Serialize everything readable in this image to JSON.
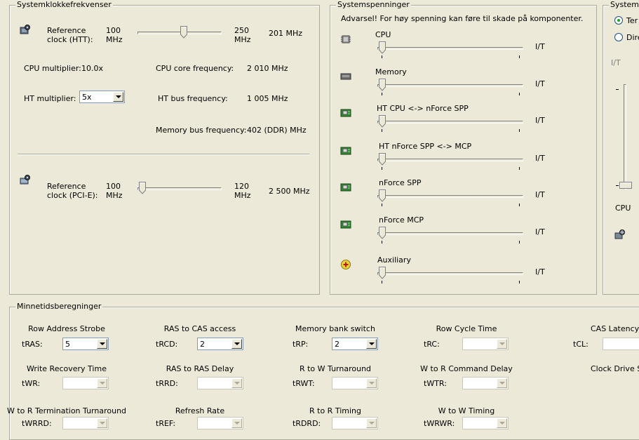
{
  "clock": {
    "title": "Systemklokkefrekvenser",
    "htt": {
      "label_line1": "Reference",
      "label_line2": "clock (HTT):",
      "min_val": "100",
      "min_unit": "MHz",
      "max_val": "250",
      "max_unit": "MHz",
      "value": "201 MHz",
      "slider_fraction": 0.54
    },
    "cpu_multiplier_label": "CPU multiplier:",
    "cpu_multiplier_value": "10.0x",
    "cpu_core_label": "CPU core frequency:",
    "cpu_core_value": "2 010 MHz",
    "ht_multiplier_label": "HT multiplier:",
    "ht_multiplier_value": "5x",
    "ht_bus_label": "HT bus frequency:",
    "ht_bus_value": "1 005 MHz",
    "memory_bus_label": "Memory bus frequency:",
    "memory_bus_value": "402 (DDR) MHz",
    "pcie": {
      "label_line1": "Reference",
      "label_line2": "clock (PCI-E):",
      "min_val": "100",
      "min_unit": "MHz",
      "max_val": "120",
      "max_unit": "MHz",
      "value": "2 500 MHz",
      "slider_fraction": 0.0
    }
  },
  "voltages": {
    "title": "Systemspenninger",
    "warning": "Advarsel! For høy spenning kan føre til skade på komponenter.",
    "items": [
      {
        "label": "CPU",
        "value": "I/T",
        "icon": "cpu-icon"
      },
      {
        "label": "Memory",
        "value": "I/T",
        "icon": "memory-icon"
      },
      {
        "label": "HT CPU <-> nForce SPP",
        "value": "I/T",
        "icon": "chipset-icon"
      },
      {
        "label": "HT nForce SPP <-> MCP",
        "value": "I/T",
        "icon": "chipset-icon"
      },
      {
        "label": "nForce SPP",
        "value": "I/T",
        "icon": "chipset-icon"
      },
      {
        "label": "nForce MCP",
        "value": "I/T",
        "icon": "chipset-icon"
      },
      {
        "label": "Auxiliary",
        "value": "I/T",
        "icon": "auxiliary-plus-icon"
      }
    ]
  },
  "fans": {
    "title": "Systemv",
    "radio1": "Ter",
    "radio2": "Dire",
    "value": "I/T",
    "slider_label": "CPU"
  },
  "memory_timings": {
    "title": "Minnetidsberegninger",
    "rows": [
      [
        {
          "title": "Row Address Strobe",
          "code": "tRAS:",
          "value": "5"
        },
        {
          "title": "RAS to CAS access",
          "code": "tRCD:",
          "value": "2"
        },
        {
          "title": "Memory bank switch",
          "code": "tRP:",
          "value": "2"
        },
        {
          "title": "Row Cycle Time",
          "code": "tRC:",
          "value": ""
        },
        {
          "title": "CAS Latency",
          "code": "tCL:",
          "value": ""
        }
      ],
      [
        {
          "title": "Write Recovery Time",
          "code": "tWR:",
          "value": ""
        },
        {
          "title": "RAS to RAS Delay",
          "code": "tRRD:",
          "value": ""
        },
        {
          "title": "R to W Turnaround",
          "code": "tRWT:",
          "value": ""
        },
        {
          "title": "W to R Command Delay",
          "code": "tWTR:",
          "value": ""
        },
        {
          "title": "Clock Drive St",
          "code": "",
          "value": ""
        }
      ],
      [
        {
          "title": "W to R Termination Turnaround",
          "code": "tWRRD:",
          "value": ""
        },
        {
          "title": "Refresh Rate",
          "code": "tREF:",
          "value": ""
        },
        {
          "title": "R to R Timing",
          "code": "tRDRD:",
          "value": ""
        },
        {
          "title": "W to W Timing",
          "code": "tWRWR:",
          "value": ""
        }
      ]
    ]
  }
}
